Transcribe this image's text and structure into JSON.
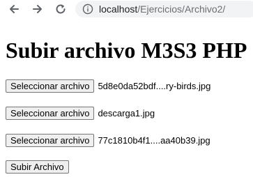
{
  "browser": {
    "url_host": "localhost",
    "url_path": "/Ejercicios/Archivo2/",
    "icons": {
      "back": "back-arrow-icon",
      "forward": "forward-arrow-icon",
      "reload": "reload-icon",
      "info": "info-icon"
    }
  },
  "page": {
    "title": "Subir archivo M3S3 PHP",
    "file_inputs": [
      {
        "button_label": "Seleccionar archivo",
        "file_name": "5d8e0da52bdf....ry-birds.jpg"
      },
      {
        "button_label": "Seleccionar archivo",
        "file_name": "descarga1.jpg"
      },
      {
        "button_label": "Seleccionar archivo",
        "file_name": "77c1810b4f1....aa40b39.jpg"
      }
    ],
    "submit_label": "Subir Archivo"
  },
  "colors": {
    "omnibox_bg": "#f1f3f4",
    "button_bg": "#efefef",
    "button_border": "#767676",
    "url_path_text": "#6b6e72"
  }
}
